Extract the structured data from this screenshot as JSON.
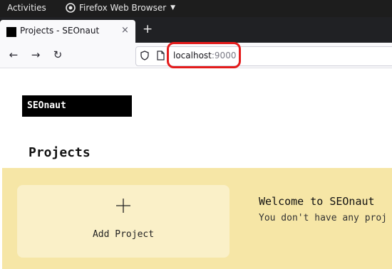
{
  "system_bar": {
    "activities_label": "Activities",
    "app_menu_label": "Firefox Web Browser"
  },
  "browser": {
    "tab": {
      "title": "Projects - SEOnaut",
      "close_glyph": "×"
    },
    "new_tab_glyph": "+",
    "url": {
      "host": "localhost",
      "port": ":9000"
    },
    "icons": [
      "back-arrow-icon",
      "forward-arrow-icon",
      "reload-icon",
      "shield-icon",
      "page-icon",
      "close-icon",
      "plus-icon",
      "firefox-icon",
      "chevron-down-icon"
    ]
  },
  "page": {
    "logo": "SEOnaut",
    "heading": "Projects",
    "add_project_label": "Add Project",
    "welcome_title": "Welcome to SEOnaut",
    "welcome_text": "You don't have any proj"
  },
  "colors": {
    "annotation_highlight": "#e41b1b",
    "panel_background": "#f6e6a6",
    "card_background": "#faf0c8"
  }
}
